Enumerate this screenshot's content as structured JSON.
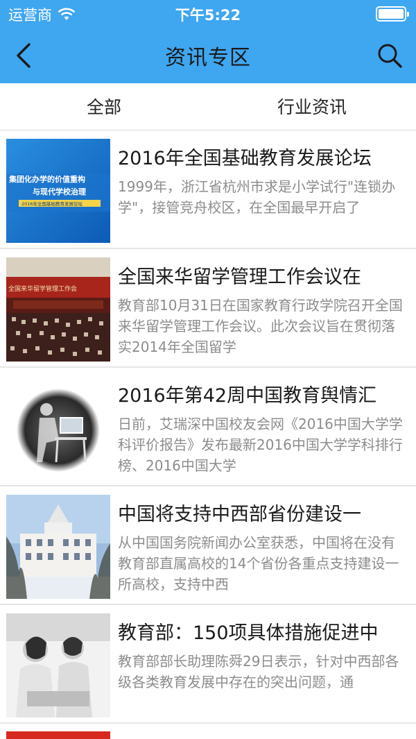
{
  "status_bar": {
    "carrier": "运营商",
    "time": "下午5:22"
  },
  "nav": {
    "title": "资讯专区",
    "back_icon": "chevron-left-icon",
    "search_icon": "search-icon"
  },
  "tabs": [
    {
      "label": "全部"
    },
    {
      "label": "行业资讯"
    }
  ],
  "articles": [
    {
      "title": "2016年全国基础教育发展论坛",
      "desc": "1999年，浙江省杭州市求是小学试行\"连锁办学\"，接管竞舟校区，在全国最早开启了",
      "thumb_lines": [
        "集团化办学的价值重构",
        "与现代学校治理",
        "2016年全国基础教育发展论坛"
      ]
    },
    {
      "title": "全国来华留学管理工作会议在",
      "desc": "教育部10月31日在国家教育行政学院召开全国来华留学管理工作会议。此次会议旨在贯彻落实2014年全国留学",
      "thumb_lines": [
        "全国来华留学管理工作会"
      ]
    },
    {
      "title": "2016年第42周中国教育舆情汇",
      "desc": "日前，艾瑞深中国校友会网《2016中国大学学科评价报告》发布最新2016中国大学学科排行榜、2016中国大学",
      "thumb_lines": []
    },
    {
      "title": "中国将支持中西部省份建设一",
      "desc": "从中国国务院新闻办公室获悉，中国将在没有教育部直属高校的14个省份各重点支持建设一所高校，支持中西",
      "thumb_lines": []
    },
    {
      "title": "教育部：150项具体措施促进中",
      "desc": "教育部部长助理陈舜29日表示，针对中西部各级各类教育发展中存在的突出问题，通",
      "thumb_lines": []
    }
  ]
}
